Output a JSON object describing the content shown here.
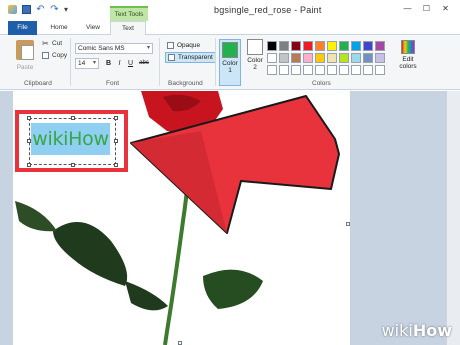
{
  "window": {
    "title": "bgsingle_red_rose - Paint",
    "contextual_tab_group": "Text Tools"
  },
  "tabs": {
    "file": "File",
    "home": "Home",
    "view": "View",
    "text": "Text"
  },
  "clipboard": {
    "paste": "Paste",
    "cut": "Cut",
    "copy": "Copy",
    "group_label": "Clipboard"
  },
  "font": {
    "family": "Comic Sans MS",
    "size": "14",
    "bold": "B",
    "italic": "I",
    "underline": "U",
    "strike": "abc",
    "group_label": "Font"
  },
  "background": {
    "opaque": "Opaque",
    "transparent": "Transparent",
    "selected": "Transparent",
    "group_label": "Background"
  },
  "colors": {
    "color1_label_line1": "Color",
    "color1_label_line2": "1",
    "color2_label_line1": "Color",
    "color2_label_line2": "2",
    "color1_value": "#22b14c",
    "color2_value": "#ffffff",
    "edit_colors_line1": "Edit",
    "edit_colors_line2": "colors",
    "group_label": "Colors",
    "palette_row1": [
      "#000000",
      "#7f7f7f",
      "#880015",
      "#ed1c24",
      "#ff7f27",
      "#fff200",
      "#22b14c",
      "#00a2e8",
      "#3f48cc",
      "#a349a4"
    ],
    "palette_row2": [
      "#ffffff",
      "#c3c3c3",
      "#b97a57",
      "#ffaec9",
      "#ffc90e",
      "#efe4b0",
      "#b5e61d",
      "#99d9ea",
      "#7092be",
      "#c8bfe7"
    ],
    "palette_row3": [
      "#ffffff",
      "#ffffff",
      "#ffffff",
      "#ffffff",
      "#ffffff",
      "#ffffff",
      "#ffffff",
      "#ffffff",
      "#ffffff",
      "#ffffff"
    ]
  },
  "canvas": {
    "text_box_content": "wikiHow",
    "text_color": "#3aa545",
    "text_background": "#8fd0f2",
    "highlight_color": "#e8333d",
    "arrow_color": "#e8333d"
  },
  "watermark": {
    "wiki": "wiki",
    "how": "How"
  }
}
